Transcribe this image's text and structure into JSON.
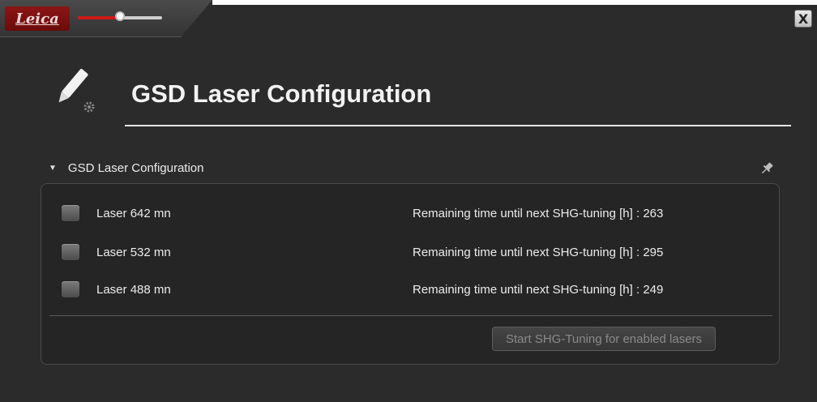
{
  "header": {
    "logo_text": "Leica",
    "slider_value_percent": 50,
    "close_label": "X"
  },
  "page": {
    "title": "GSD Laser Configuration"
  },
  "section": {
    "title": "GSD Laser Configuration"
  },
  "lasers": [
    {
      "label": "Laser 642 mn",
      "remaining_label": "Remaining time until next SHG-tuning [h] :",
      "remaining_value": "263",
      "checked": false
    },
    {
      "label": "Laser 532 mn",
      "remaining_label": "Remaining time until next SHG-tuning [h] :",
      "remaining_value": "295",
      "checked": false
    },
    {
      "label": "Laser 488 mn",
      "remaining_label": "Remaining time until next SHG-tuning [h] :",
      "remaining_value": "249",
      "checked": false
    }
  ],
  "actions": {
    "start_label": "Start SHG-Tuning for enabled lasers"
  },
  "colors": {
    "background": "#2b2b2b",
    "accent_red": "#d01818",
    "disabled_text": "#8a8a8a"
  },
  "icons": {
    "title_icon": "pencil-gear-icon",
    "pin_icon": "pin-icon",
    "close_icon": "close-icon"
  }
}
